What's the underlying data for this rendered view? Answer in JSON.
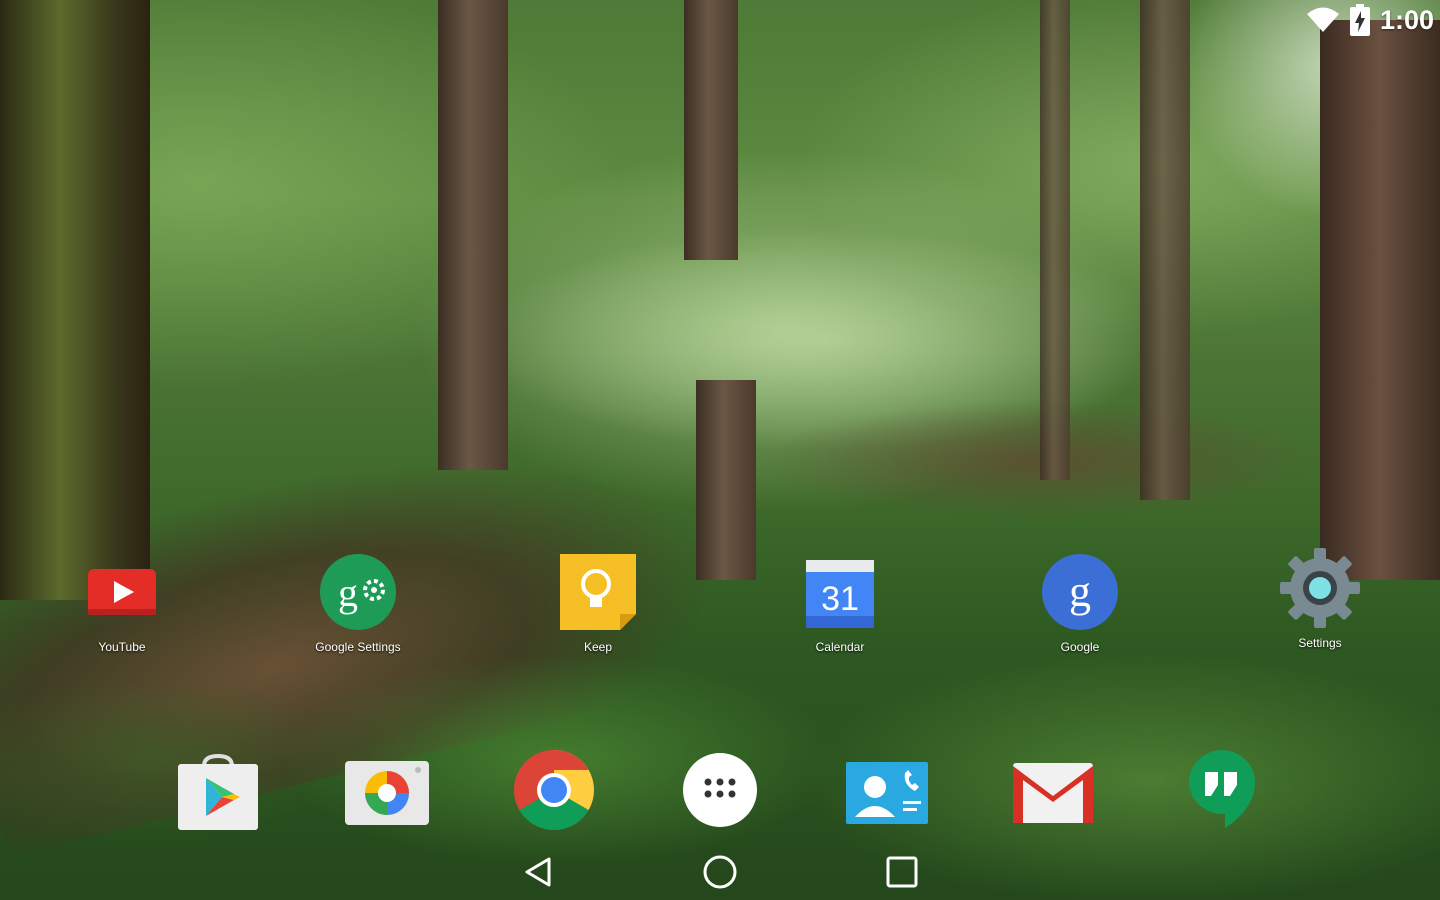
{
  "status_bar": {
    "time": "1:00",
    "wifi_icon": "wifi-icon",
    "battery_icon": "battery-charging-icon"
  },
  "workspace": {
    "apps": [
      {
        "label": "YouTube",
        "icon": "youtube-icon",
        "color": "#e52d27"
      },
      {
        "label": "Google Settings",
        "icon": "google-settings-icon",
        "color": "#1e9b57"
      },
      {
        "label": "Keep",
        "icon": "keep-icon",
        "color": "#f6bf26"
      },
      {
        "label": "Calendar",
        "icon": "calendar-icon",
        "color": "#4285f4",
        "date": "31"
      },
      {
        "label": "Google",
        "icon": "google-icon",
        "color": "#3b6fd6",
        "glyph": "g"
      },
      {
        "label": "Settings",
        "icon": "settings-icon",
        "color": "#7a8a92"
      }
    ]
  },
  "dock": {
    "items": [
      {
        "name": "play-store",
        "icon": "play-store-icon"
      },
      {
        "name": "photos",
        "icon": "photos-icon"
      },
      {
        "name": "chrome",
        "icon": "chrome-icon"
      },
      {
        "name": "all-apps",
        "icon": "app-drawer-icon"
      },
      {
        "name": "contacts",
        "icon": "contacts-icon"
      },
      {
        "name": "gmail",
        "icon": "gmail-icon"
      },
      {
        "name": "hangouts",
        "icon": "hangouts-icon"
      }
    ]
  },
  "nav_bar": {
    "back": "back-icon",
    "home": "home-icon",
    "recents": "recents-icon"
  }
}
